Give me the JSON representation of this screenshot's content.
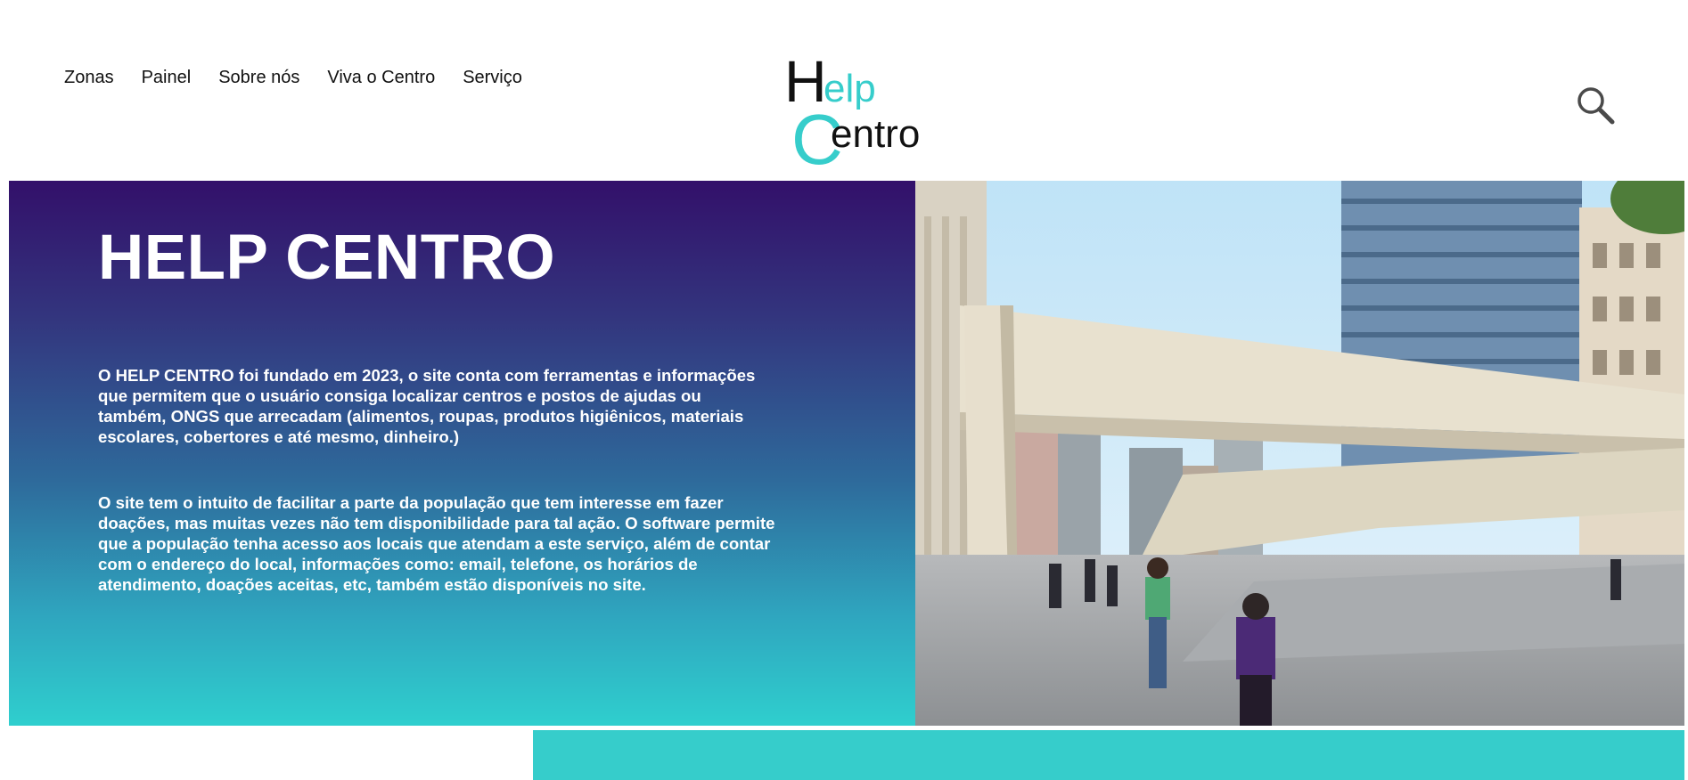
{
  "nav": {
    "items": [
      {
        "label": "Zonas"
      },
      {
        "label": "Painel"
      },
      {
        "label": "Sobre nós"
      },
      {
        "label": "Viva o Centro"
      },
      {
        "label": "Serviço"
      }
    ]
  },
  "logo": {
    "line1": "elp",
    "line2": "entro",
    "h": "H",
    "c": "C"
  },
  "search": {
    "icon": "search-icon"
  },
  "hero": {
    "title": "HELP CENTRO",
    "paragraph1": "O HELP CENTRO foi fundado em 2023, o site conta com ferramentas e informações que permitem que o usuário consiga localizar centros e postos de ajudas ou também, ONGS que arrecadam (alimentos, roupas, produtos higiênicos, materiais escolares, cobertores e até mesmo, dinheiro.)",
    "paragraph2": "O site tem o intuito de facilitar a parte da população que tem interesse em fazer doações, mas muitas vezes não tem disponibilidade para tal ação. O software permite que a população tenha acesso aos locais que atendam a este serviço, além de contar com o endereço do local, informações como: email, telefone, os horários de atendimento, doações aceitas, etc, também estão disponíveis no site."
  },
  "colors": {
    "brand_teal": "#36cdcb",
    "gradient_top": "#33106a",
    "gradient_bottom": "#2fcfce",
    "logo_dark": "#111111"
  }
}
